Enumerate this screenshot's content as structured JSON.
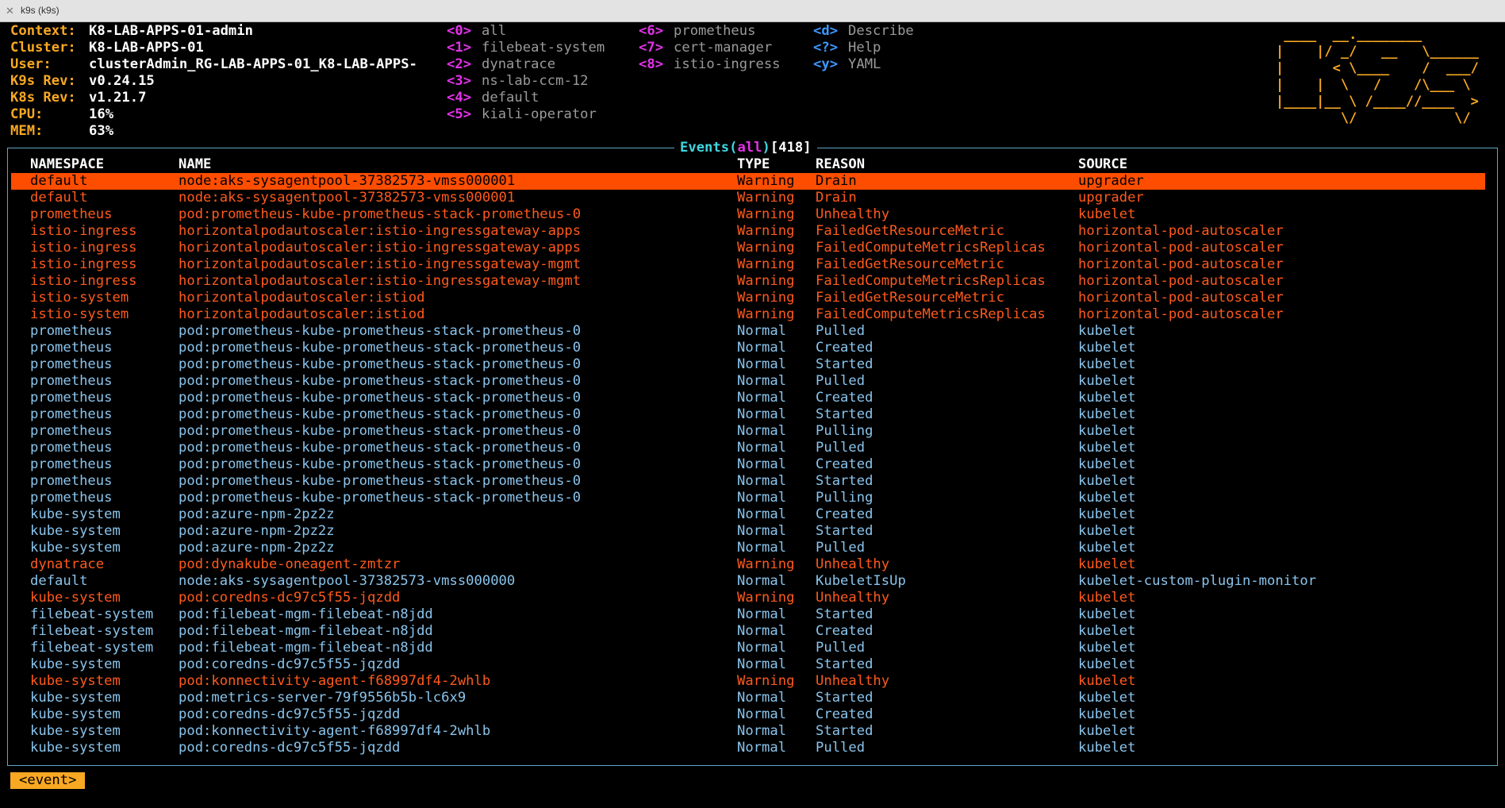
{
  "window": {
    "title": "k9s (k9s)"
  },
  "info": [
    {
      "label": "Context:",
      "value": "K8-LAB-APPS-01-admin"
    },
    {
      "label": "Cluster:",
      "value": "K8-LAB-APPS-01"
    },
    {
      "label": "User:",
      "value": "clusterAdmin_RG-LAB-APPS-01_K8-LAB-APPS-"
    },
    {
      "label": "K9s Rev:",
      "value": "v0.24.15"
    },
    {
      "label": "K8s Rev:",
      "value": "v1.21.7"
    },
    {
      "label": "CPU:",
      "value": "16%"
    },
    {
      "label": "MEM:",
      "value": "63%"
    }
  ],
  "namespaces": [
    {
      "key": "<0>",
      "name": "all"
    },
    {
      "key": "<1>",
      "name": "filebeat-system"
    },
    {
      "key": "<2>",
      "name": "dynatrace"
    },
    {
      "key": "<3>",
      "name": "ns-lab-ccm-12"
    },
    {
      "key": "<4>",
      "name": "default"
    },
    {
      "key": "<5>",
      "name": "kiali-operator"
    },
    {
      "key": "<6>",
      "name": "prometheus"
    },
    {
      "key": "<7>",
      "name": "cert-manager"
    },
    {
      "key": "<8>",
      "name": "istio-ingress"
    }
  ],
  "actions": [
    {
      "key": "<d>",
      "name": "Describe"
    },
    {
      "key": "<?>",
      "name": "Help"
    },
    {
      "key": "<y>",
      "name": "YAML"
    }
  ],
  "logo": " ____  __.________        \n|    |/ _/   __   \\______ \n|      < \\____    /  ___/ \n|    |  \\   /    /\\___ \\  \n|____|__ \\ /____//____  > \n        \\/            \\/  ",
  "table": {
    "title": "Events",
    "filter": "all",
    "count": "418",
    "headers": {
      "namespace": "NAMESPACE",
      "name": "NAME",
      "type": "TYPE",
      "reason": "REASON",
      "source": "SOURCE"
    },
    "rows": [
      {
        "namespace": "default",
        "name": "node:aks-sysagentpool-37382573-vmss000001",
        "type": "Warning",
        "reason": "Drain",
        "source": "upgrader",
        "selected": true
      },
      {
        "namespace": "default",
        "name": "node:aks-sysagentpool-37382573-vmss000001",
        "type": "Warning",
        "reason": "Drain",
        "source": "upgrader"
      },
      {
        "namespace": "prometheus",
        "name": "pod:prometheus-kube-prometheus-stack-prometheus-0",
        "type": "Warning",
        "reason": "Unhealthy",
        "source": "kubelet"
      },
      {
        "namespace": "istio-ingress",
        "name": "horizontalpodautoscaler:istio-ingressgateway-apps",
        "type": "Warning",
        "reason": "FailedGetResourceMetric",
        "source": "horizontal-pod-autoscaler"
      },
      {
        "namespace": "istio-ingress",
        "name": "horizontalpodautoscaler:istio-ingressgateway-apps",
        "type": "Warning",
        "reason": "FailedComputeMetricsReplicas",
        "source": "horizontal-pod-autoscaler"
      },
      {
        "namespace": "istio-ingress",
        "name": "horizontalpodautoscaler:istio-ingressgateway-mgmt",
        "type": "Warning",
        "reason": "FailedGetResourceMetric",
        "source": "horizontal-pod-autoscaler"
      },
      {
        "namespace": "istio-ingress",
        "name": "horizontalpodautoscaler:istio-ingressgateway-mgmt",
        "type": "Warning",
        "reason": "FailedComputeMetricsReplicas",
        "source": "horizontal-pod-autoscaler"
      },
      {
        "namespace": "istio-system",
        "name": "horizontalpodautoscaler:istiod",
        "type": "Warning",
        "reason": "FailedGetResourceMetric",
        "source": "horizontal-pod-autoscaler"
      },
      {
        "namespace": "istio-system",
        "name": "horizontalpodautoscaler:istiod",
        "type": "Warning",
        "reason": "FailedComputeMetricsReplicas",
        "source": "horizontal-pod-autoscaler"
      },
      {
        "namespace": "prometheus",
        "name": "pod:prometheus-kube-prometheus-stack-prometheus-0",
        "type": "Normal",
        "reason": "Pulled",
        "source": "kubelet"
      },
      {
        "namespace": "prometheus",
        "name": "pod:prometheus-kube-prometheus-stack-prometheus-0",
        "type": "Normal",
        "reason": "Created",
        "source": "kubelet"
      },
      {
        "namespace": "prometheus",
        "name": "pod:prometheus-kube-prometheus-stack-prometheus-0",
        "type": "Normal",
        "reason": "Started",
        "source": "kubelet"
      },
      {
        "namespace": "prometheus",
        "name": "pod:prometheus-kube-prometheus-stack-prometheus-0",
        "type": "Normal",
        "reason": "Pulled",
        "source": "kubelet"
      },
      {
        "namespace": "prometheus",
        "name": "pod:prometheus-kube-prometheus-stack-prometheus-0",
        "type": "Normal",
        "reason": "Created",
        "source": "kubelet"
      },
      {
        "namespace": "prometheus",
        "name": "pod:prometheus-kube-prometheus-stack-prometheus-0",
        "type": "Normal",
        "reason": "Started",
        "source": "kubelet"
      },
      {
        "namespace": "prometheus",
        "name": "pod:prometheus-kube-prometheus-stack-prometheus-0",
        "type": "Normal",
        "reason": "Pulling",
        "source": "kubelet"
      },
      {
        "namespace": "prometheus",
        "name": "pod:prometheus-kube-prometheus-stack-prometheus-0",
        "type": "Normal",
        "reason": "Pulled",
        "source": "kubelet"
      },
      {
        "namespace": "prometheus",
        "name": "pod:prometheus-kube-prometheus-stack-prometheus-0",
        "type": "Normal",
        "reason": "Created",
        "source": "kubelet"
      },
      {
        "namespace": "prometheus",
        "name": "pod:prometheus-kube-prometheus-stack-prometheus-0",
        "type": "Normal",
        "reason": "Started",
        "source": "kubelet"
      },
      {
        "namespace": "prometheus",
        "name": "pod:prometheus-kube-prometheus-stack-prometheus-0",
        "type": "Normal",
        "reason": "Pulling",
        "source": "kubelet"
      },
      {
        "namespace": "kube-system",
        "name": "pod:azure-npm-2pz2z",
        "type": "Normal",
        "reason": "Created",
        "source": "kubelet"
      },
      {
        "namespace": "kube-system",
        "name": "pod:azure-npm-2pz2z",
        "type": "Normal",
        "reason": "Started",
        "source": "kubelet"
      },
      {
        "namespace": "kube-system",
        "name": "pod:azure-npm-2pz2z",
        "type": "Normal",
        "reason": "Pulled",
        "source": "kubelet"
      },
      {
        "namespace": "dynatrace",
        "name": "pod:dynakube-oneagent-zmtzr",
        "type": "Warning",
        "reason": "Unhealthy",
        "source": "kubelet"
      },
      {
        "namespace": "default",
        "name": "node:aks-sysagentpool-37382573-vmss000000",
        "type": "Normal",
        "reason": "KubeletIsUp",
        "source": "kubelet-custom-plugin-monitor"
      },
      {
        "namespace": "kube-system",
        "name": "pod:coredns-dc97c5f55-jqzdd",
        "type": "Warning",
        "reason": "Unhealthy",
        "source": "kubelet"
      },
      {
        "namespace": "filebeat-system",
        "name": "pod:filebeat-mgm-filebeat-n8jdd",
        "type": "Normal",
        "reason": "Started",
        "source": "kubelet"
      },
      {
        "namespace": "filebeat-system",
        "name": "pod:filebeat-mgm-filebeat-n8jdd",
        "type": "Normal",
        "reason": "Created",
        "source": "kubelet"
      },
      {
        "namespace": "filebeat-system",
        "name": "pod:filebeat-mgm-filebeat-n8jdd",
        "type": "Normal",
        "reason": "Pulled",
        "source": "kubelet"
      },
      {
        "namespace": "kube-system",
        "name": "pod:coredns-dc97c5f55-jqzdd",
        "type": "Normal",
        "reason": "Started",
        "source": "kubelet"
      },
      {
        "namespace": "kube-system",
        "name": "pod:konnectivity-agent-f68997df4-2whlb",
        "type": "Warning",
        "reason": "Unhealthy",
        "source": "kubelet"
      },
      {
        "namespace": "kube-system",
        "name": "pod:metrics-server-79f9556b5b-lc6x9",
        "type": "Normal",
        "reason": "Started",
        "source": "kubelet"
      },
      {
        "namespace": "kube-system",
        "name": "pod:coredns-dc97c5f55-jqzdd",
        "type": "Normal",
        "reason": "Created",
        "source": "kubelet"
      },
      {
        "namespace": "kube-system",
        "name": "pod:konnectivity-agent-f68997df4-2whlb",
        "type": "Normal",
        "reason": "Started",
        "source": "kubelet"
      },
      {
        "namespace": "kube-system",
        "name": "pod:coredns-dc97c5f55-jqzdd",
        "type": "Normal",
        "reason": "Pulled",
        "source": "kubelet"
      }
    ]
  },
  "crumb": "<event>",
  "colors": {
    "accent": "#f8a823",
    "hotkey": "#e232e8",
    "action_key": "#3d98ff",
    "normal_row": "#8ac4ec",
    "warning_row": "#ff5a1c",
    "selected_bg": "#ff4d00",
    "frame_title": "#41d4df"
  }
}
